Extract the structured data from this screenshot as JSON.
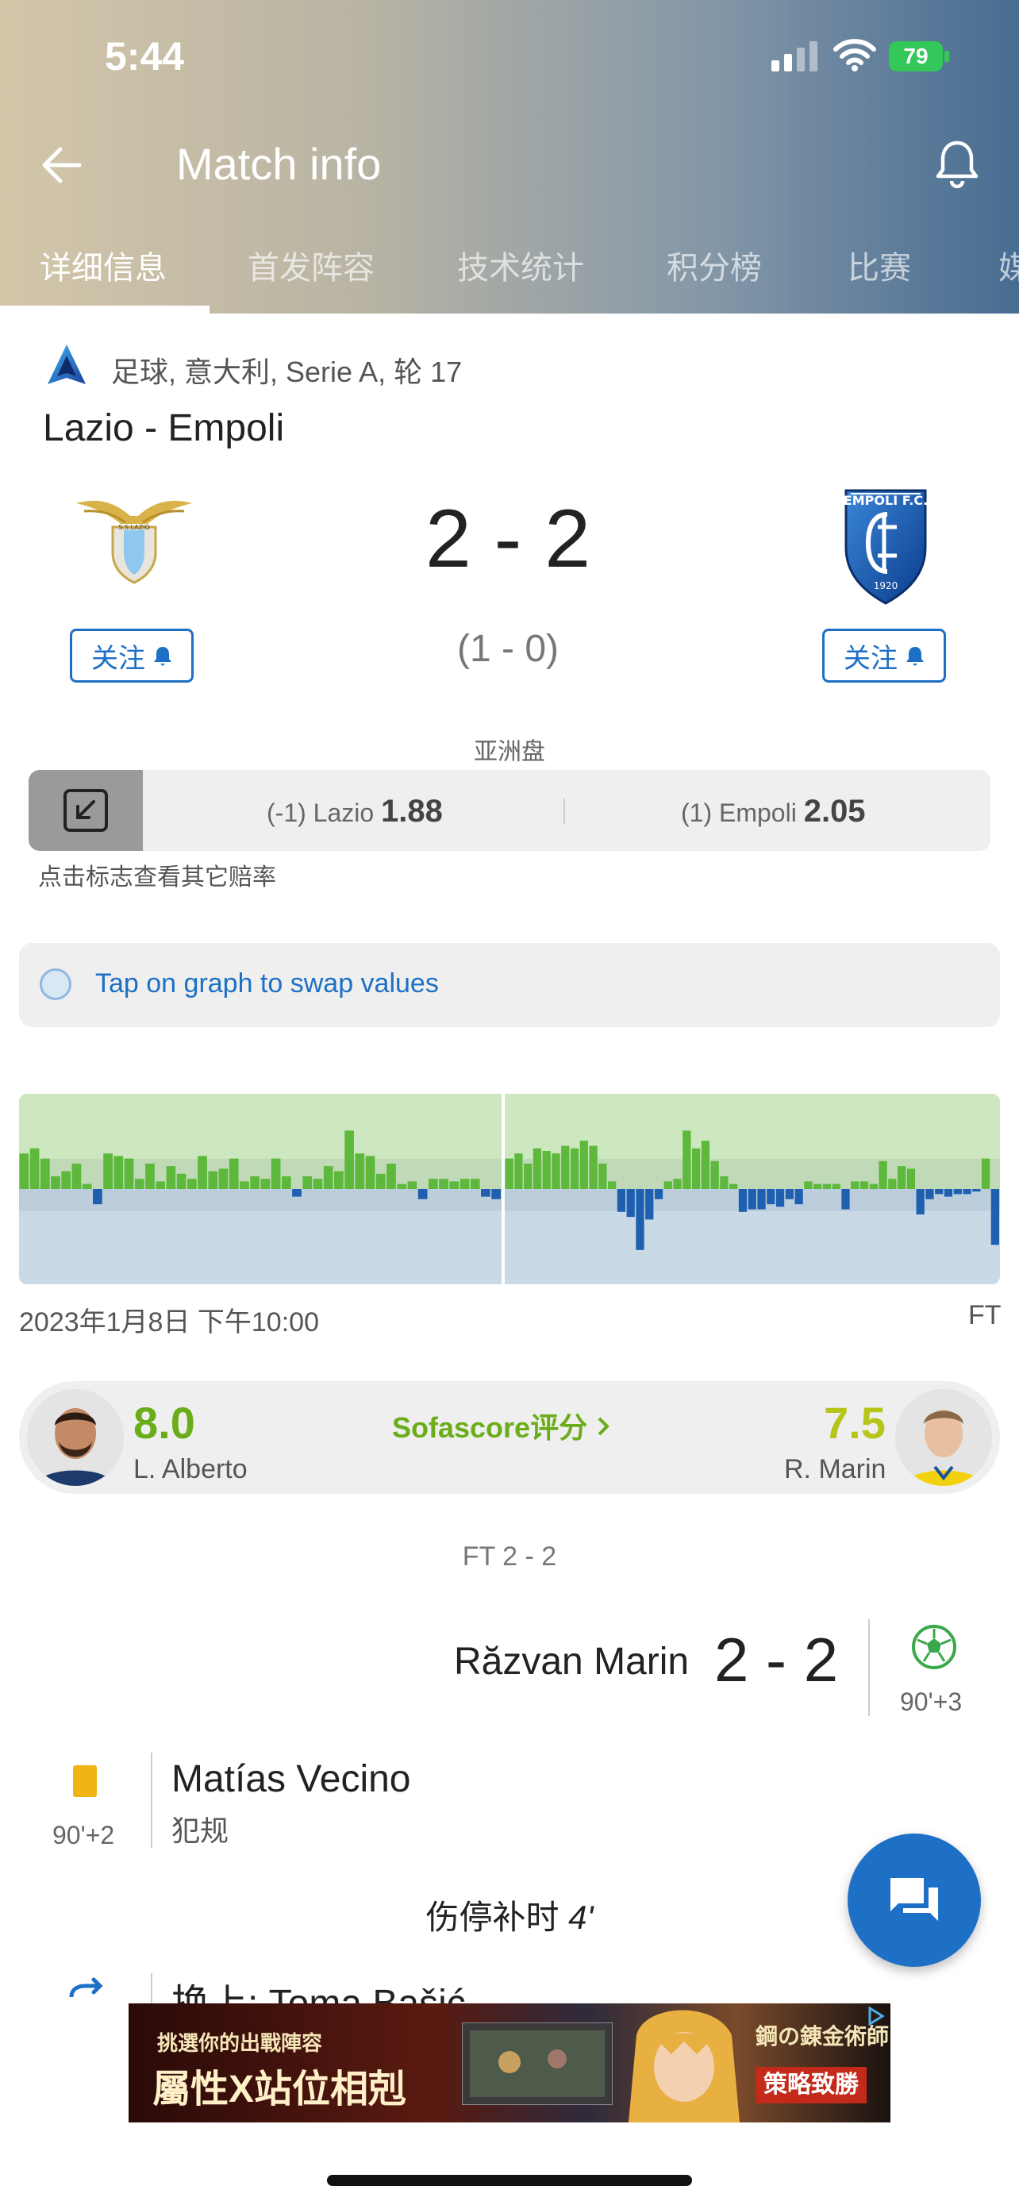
{
  "status_bar": {
    "time": "5:44",
    "battery": "79"
  },
  "header": {
    "title": "Match info"
  },
  "tabs": [
    {
      "label": "详细信息"
    },
    {
      "label": "首发阵容"
    },
    {
      "label": "技术统计"
    },
    {
      "label": "积分榜"
    },
    {
      "label": "比赛"
    },
    {
      "label": "媒"
    }
  ],
  "match": {
    "league_text": "足球, 意大利, Serie A, 轮 17",
    "title": "Lazio - Empoli",
    "score": "2 - 2",
    "halftime": "(1 - 0)",
    "follow_label": "关注"
  },
  "odds": {
    "section_label": "亚洲盘",
    "home_label": "(-1) Lazio",
    "home_value": "1.88",
    "away_label": "(1) Empoli",
    "away_value": "2.05",
    "hint": "点击标志查看其它赔率"
  },
  "swap": {
    "label": "Tap on graph to swap values"
  },
  "graph": {
    "date": "2023年1月8日 下午10:00",
    "status": "FT",
    "colors": {
      "positive": "#5db83c",
      "negative": "#1f5fb0",
      "top_bg": "#cde7c0",
      "bottom_bg": "#c9d9e6"
    },
    "first_half": [
      14,
      16,
      12,
      5,
      7,
      10,
      2,
      -6,
      14,
      13,
      12,
      4,
      10,
      3,
      9,
      6,
      4,
      13,
      7,
      8,
      12,
      3,
      5,
      4,
      12,
      5,
      -3,
      5,
      4,
      9,
      7,
      23,
      14,
      13,
      6,
      10,
      2,
      3,
      -4,
      4,
      4,
      3,
      4,
      4,
      -3,
      -4
    ],
    "second_half": [
      12,
      14,
      10,
      16,
      15,
      14,
      17,
      16,
      19,
      17,
      10,
      3,
      -9,
      -11,
      -24,
      -12,
      -4,
      3,
      4,
      23,
      16,
      19,
      11,
      5,
      2,
      -9,
      -8,
      -8,
      -6,
      -7,
      -4,
      -6,
      3,
      2,
      2,
      2,
      -8,
      3,
      3,
      2,
      11,
      4,
      9,
      8,
      -10,
      -4,
      -2,
      -3,
      -2,
      -2,
      -1,
      12,
      -22
    ]
  },
  "ratings": {
    "left_value": "8.0",
    "left_name": "L. Alberto",
    "link_label": "Sofascore评分",
    "right_value": "7.5",
    "right_name": "R. Marin"
  },
  "events": {
    "ft_label": "FT 2 - 2",
    "goal": {
      "player": "Răzvan Marin",
      "score": "2 - 2",
      "time": "90'+3"
    },
    "yellow_card": {
      "player": "Matías Vecino",
      "reason": "犯规",
      "time": "90'+2"
    },
    "added_time_prefix": "伤停补时",
    "added_time_value": "4'",
    "substitution": {
      "player": "换上: Toma Bašić"
    }
  },
  "ad": {
    "line1": "挑選你的出戰陣容",
    "line2": "屬性X站位相剋",
    "brand": "鋼の錬金術師",
    "cta": "策略致勝"
  }
}
